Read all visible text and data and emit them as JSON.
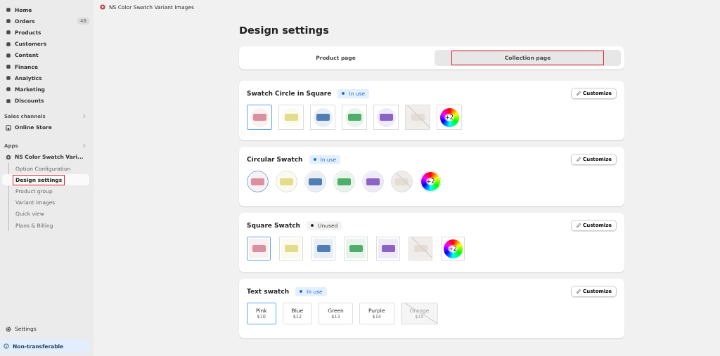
{
  "sidebar": {
    "items": [
      {
        "label": "Home"
      },
      {
        "label": "Orders",
        "badge": "48"
      },
      {
        "label": "Products"
      },
      {
        "label": "Customers"
      },
      {
        "label": "Content"
      },
      {
        "label": "Finance"
      },
      {
        "label": "Analytics"
      },
      {
        "label": "Marketing"
      },
      {
        "label": "Discounts"
      }
    ],
    "sales_channels": {
      "heading": "Sales channels",
      "items": [
        {
          "label": "Online Store"
        }
      ]
    },
    "apps": {
      "heading": "Apps",
      "app": {
        "label": "NS Color Swatch Vari...",
        "children": [
          {
            "label": "Option Configuration",
            "selected": false,
            "highlighted": false
          },
          {
            "label": "Design settings",
            "selected": true,
            "highlighted": true
          },
          {
            "label": "Product group",
            "selected": false,
            "highlighted": false
          },
          {
            "label": "Variant images",
            "selected": false,
            "highlighted": false
          },
          {
            "label": "Quick view",
            "selected": false,
            "highlighted": false
          },
          {
            "label": "Plans & Billing",
            "selected": false,
            "highlighted": false
          }
        ]
      }
    },
    "settings": "Settings",
    "notice": "Non-transferable"
  },
  "topbar": {
    "title": "NS Color Swatch Variant Images"
  },
  "page": {
    "title": "Design settings",
    "tabs": [
      {
        "label": "Product page",
        "selected": false,
        "highlighted": false
      },
      {
        "label": "Collection page",
        "selected": true,
        "highlighted": true
      }
    ],
    "sections": [
      {
        "kind": "circle_in_square",
        "title": "Swatch Circle in Square",
        "status": {
          "label": "In use",
          "active": true
        },
        "button": "Customize",
        "swatches": [
          {
            "color": "#d9909f",
            "selected": true,
            "disabled": false
          },
          {
            "color": "#e3dc8a",
            "selected": false,
            "disabled": false
          },
          {
            "color": "#4f7fb5",
            "selected": false,
            "disabled": false
          },
          {
            "color": "#4fae6a",
            "selected": false,
            "disabled": false
          },
          {
            "color": "#8a63c4",
            "selected": false,
            "disabled": false
          },
          {
            "color": "#e6ddd2",
            "selected": false,
            "disabled": true
          },
          {
            "more": "+2",
            "selected": false,
            "disabled": false
          }
        ]
      },
      {
        "kind": "circular",
        "title": "Circular Swatch",
        "status": {
          "label": "In use",
          "active": true
        },
        "button": "Customize",
        "swatches": [
          {
            "color": "#d9909f",
            "selected": true,
            "disabled": false
          },
          {
            "color": "#e3dc8a",
            "selected": false,
            "disabled": false
          },
          {
            "color": "#4f7fb5",
            "selected": false,
            "disabled": false
          },
          {
            "color": "#4fae6a",
            "selected": false,
            "disabled": false
          },
          {
            "color": "#8a63c4",
            "selected": false,
            "disabled": false
          },
          {
            "color": "#e6ddd2",
            "selected": false,
            "disabled": true
          },
          {
            "more": "+2",
            "selected": false,
            "disabled": false
          }
        ]
      },
      {
        "kind": "square",
        "title": "Square Swatch",
        "status": {
          "label": "Unused",
          "active": false
        },
        "button": "Customize",
        "swatches": [
          {
            "color": "#d9909f",
            "selected": true,
            "disabled": false
          },
          {
            "color": "#e3dc8a",
            "selected": false,
            "disabled": false
          },
          {
            "color": "#4f7fb5",
            "selected": false,
            "disabled": false
          },
          {
            "color": "#4fae6a",
            "selected": false,
            "disabled": false
          },
          {
            "color": "#8a63c4",
            "selected": false,
            "disabled": false
          },
          {
            "color": "#e6ddd2",
            "selected": false,
            "disabled": true
          },
          {
            "more": "+2",
            "selected": false,
            "disabled": false
          }
        ]
      },
      {
        "kind": "text",
        "title": "Text swatch",
        "status": {
          "label": "In use",
          "active": true
        },
        "button": "Customize",
        "swatches": [
          {
            "name": "Pink",
            "price": "$10",
            "selected": true,
            "disabled": false
          },
          {
            "name": "Blue",
            "price": "$12",
            "selected": false,
            "disabled": false
          },
          {
            "name": "Green",
            "price": "$13",
            "selected": false,
            "disabled": false
          },
          {
            "name": "Purple",
            "price": "$14",
            "selected": false,
            "disabled": false
          },
          {
            "name": "Orange",
            "price": "$15",
            "selected": false,
            "disabled": true
          }
        ]
      }
    ]
  }
}
